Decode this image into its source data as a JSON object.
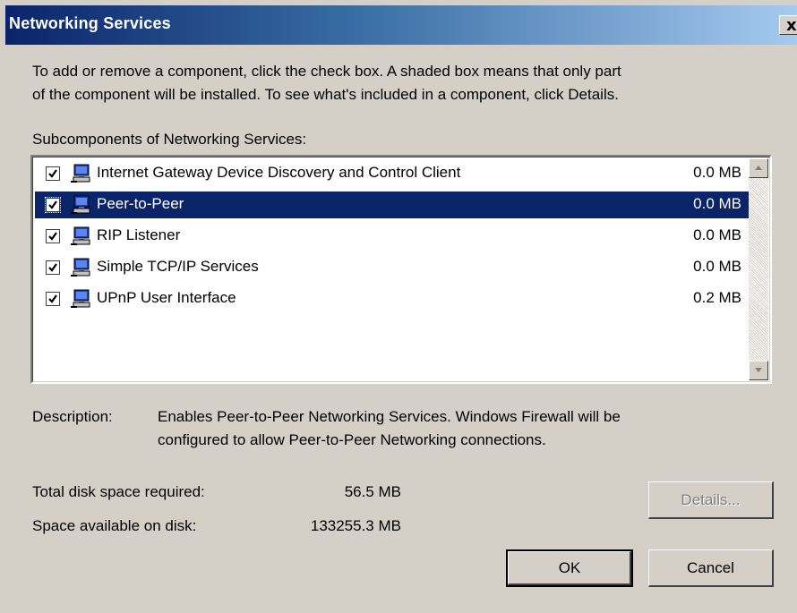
{
  "window": {
    "title": "Networking Services",
    "close_glyph": "x"
  },
  "intro": {
    "line1": "To add or remove a component, click the check box. A shaded box means that only part",
    "line2": "of the component will be installed. To see what's included in a component, click Details."
  },
  "subcomponents_label": "Subcomponents of Networking Services:",
  "components": [
    {
      "name": "Internet Gateway Device Discovery and Control Client",
      "size": "0.0 MB",
      "checked": true,
      "selected": false,
      "icon": "network-computer-icon"
    },
    {
      "name": "Peer-to-Peer",
      "size": "0.0 MB",
      "checked": true,
      "selected": true,
      "icon": "network-computer-icon"
    },
    {
      "name": "RIP Listener",
      "size": "0.0 MB",
      "checked": true,
      "selected": false,
      "icon": "network-computer-icon"
    },
    {
      "name": "Simple TCP/IP Services",
      "size": "0.0 MB",
      "checked": true,
      "selected": false,
      "icon": "network-computer-icon"
    },
    {
      "name": "UPnP User Interface",
      "size": "0.2 MB",
      "checked": true,
      "selected": false,
      "icon": "network-computer-icon"
    }
  ],
  "description": {
    "label": "Description:",
    "line1": "Enables Peer-to-Peer Networking Services. Windows Firewall will be",
    "line2": "configured to allow Peer-to-Peer Networking connections."
  },
  "disk": {
    "total_label": "Total disk space required:",
    "total_value": "56.5 MB",
    "available_label": "Space available on disk:",
    "available_value": "133255.3 MB"
  },
  "buttons": {
    "details": "Details...",
    "ok": "OK",
    "cancel": "Cancel"
  },
  "colors": {
    "title_gradient_start": "#0a246a",
    "title_gradient_end": "#a6caf0",
    "selection": "#0a246a",
    "dialog_face": "#d4d0c8"
  }
}
